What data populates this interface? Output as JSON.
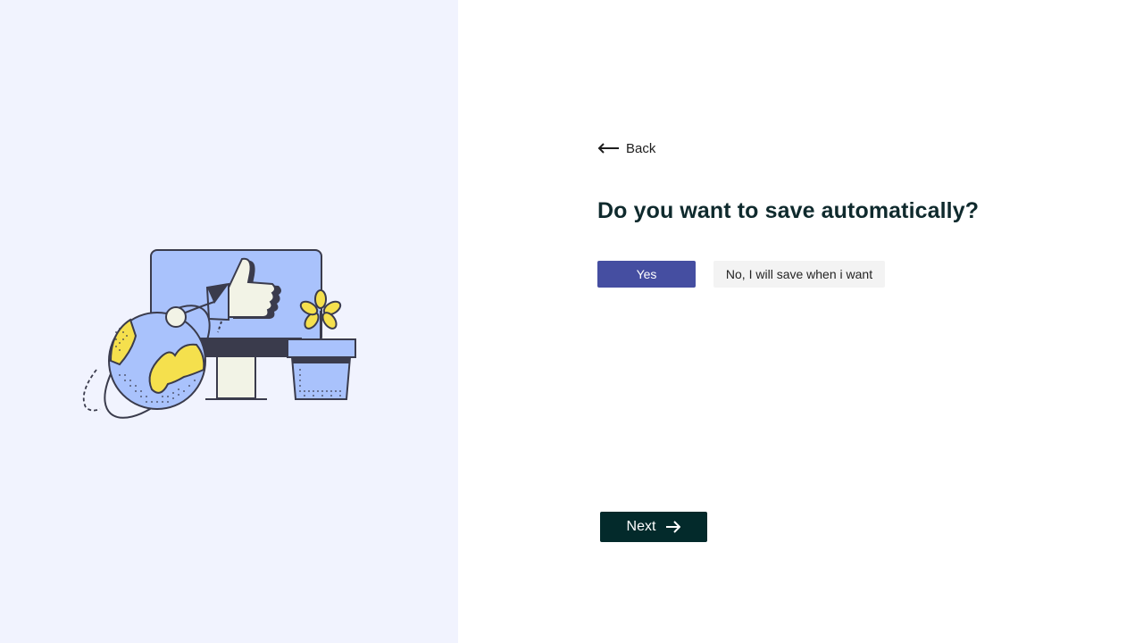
{
  "navigation": {
    "back_label": "Back",
    "back_icon": "arrow-left-icon"
  },
  "question": {
    "title": "Do you want to save automatically?"
  },
  "options": {
    "yes_label": "Yes",
    "no_label": "No, I will save when i want",
    "selected": "yes"
  },
  "footer": {
    "next_label": "Next",
    "next_icon": "arrow-right-icon"
  },
  "colors": {
    "left_panel_bg": "#f1f3fe",
    "selected_option_bg": "#454ea1",
    "unselected_option_bg": "#f3f3f3",
    "next_button_bg": "#032a2b",
    "title_color": "#0f2a2d",
    "illustration_blue": "#a9c2fc",
    "illustration_yellow": "#f5e04d",
    "illustration_dark": "#3a3b4c"
  }
}
